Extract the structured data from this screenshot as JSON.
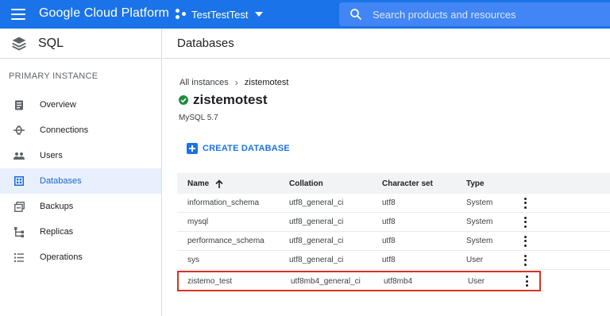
{
  "topbar": {
    "brand": "Google Cloud Platform",
    "project": "TestTestTest",
    "search_placeholder": "Search products and resources",
    "accent_color": "#1a73e8"
  },
  "sidebar": {
    "product_title": "SQL",
    "section_label": "PRIMARY INSTANCE",
    "items": [
      {
        "label": "Overview",
        "icon": "overview-icon",
        "active": false
      },
      {
        "label": "Connections",
        "icon": "connections-icon",
        "active": false
      },
      {
        "label": "Users",
        "icon": "users-icon",
        "active": false
      },
      {
        "label": "Databases",
        "icon": "databases-icon",
        "active": true
      },
      {
        "label": "Backups",
        "icon": "backups-icon",
        "active": false
      },
      {
        "label": "Replicas",
        "icon": "replicas-icon",
        "active": false
      },
      {
        "label": "Operations",
        "icon": "operations-icon",
        "active": false
      }
    ]
  },
  "main": {
    "page_title": "Databases",
    "breadcrumb": {
      "parent": "All instances",
      "current": "zistemotest"
    },
    "instance_name": "zistemotest",
    "instance_status": "running",
    "version": "MySQL 5.7",
    "create_button": "CREATE DATABASE"
  },
  "table": {
    "columns": [
      "Name",
      "Collation",
      "Character set",
      "Type"
    ],
    "sort_column": "Name",
    "rows": [
      {
        "name": "information_schema",
        "collation": "utf8_general_ci",
        "charset": "utf8",
        "type": "System"
      },
      {
        "name": "mysql",
        "collation": "utf8_general_ci",
        "charset": "utf8",
        "type": "System"
      },
      {
        "name": "performance_schema",
        "collation": "utf8_general_ci",
        "charset": "utf8",
        "type": "System"
      },
      {
        "name": "sys",
        "collation": "utf8_general_ci",
        "charset": "utf8",
        "type": "User"
      },
      {
        "name": "zistemo_test",
        "collation": "utf8mb4_general_ci",
        "charset": "utf8mb4",
        "type": "User",
        "highlighted": true
      }
    ]
  }
}
